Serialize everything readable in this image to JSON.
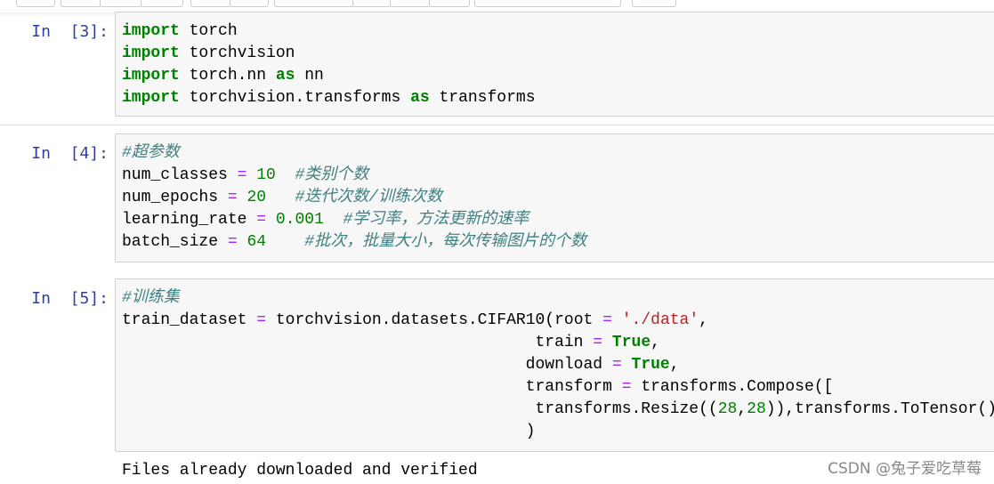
{
  "toolbar": {
    "button_count": 12
  },
  "cells": [
    {
      "prompt": "In  [3]:",
      "lines": [
        [
          {
            "t": "import",
            "c": "kw"
          },
          {
            "t": " torch"
          }
        ],
        [
          {
            "t": "import",
            "c": "kw"
          },
          {
            "t": " torchvision"
          }
        ],
        [
          {
            "t": "import",
            "c": "kw"
          },
          {
            "t": " torch.nn "
          },
          {
            "t": "as",
            "c": "kw"
          },
          {
            "t": " nn"
          }
        ],
        [
          {
            "t": "import",
            "c": "kw"
          },
          {
            "t": " torchvision.transforms "
          },
          {
            "t": "as",
            "c": "kw"
          },
          {
            "t": " transforms"
          }
        ]
      ]
    },
    {
      "prompt": "In  [4]:",
      "lines": [
        [
          {
            "t": "#超参数",
            "c": "cm"
          }
        ],
        [
          {
            "t": "num_classes "
          },
          {
            "t": "=",
            "c": "op"
          },
          {
            "t": " "
          },
          {
            "t": "10",
            "c": "num"
          },
          {
            "t": "  "
          },
          {
            "t": "#类别个数",
            "c": "cm"
          }
        ],
        [
          {
            "t": "num_epochs "
          },
          {
            "t": "=",
            "c": "op"
          },
          {
            "t": " "
          },
          {
            "t": "20",
            "c": "num"
          },
          {
            "t": "   "
          },
          {
            "t": "#迭代次数/训练次数",
            "c": "cm"
          }
        ],
        [
          {
            "t": "learning_rate "
          },
          {
            "t": "=",
            "c": "op"
          },
          {
            "t": " "
          },
          {
            "t": "0.001",
            "c": "num"
          },
          {
            "t": "  "
          },
          {
            "t": "#学习率，方法更新的速率",
            "c": "cm"
          }
        ],
        [
          {
            "t": "batch_size "
          },
          {
            "t": "=",
            "c": "op"
          },
          {
            "t": " "
          },
          {
            "t": "64",
            "c": "num"
          },
          {
            "t": "    "
          },
          {
            "t": "#批次，批量大小，每次传输图片的个数",
            "c": "cm"
          }
        ]
      ]
    },
    {
      "prompt": "In  [5]:",
      "lines": [
        [
          {
            "t": "#训练集",
            "c": "cm"
          }
        ],
        [
          {
            "t": "train_dataset "
          },
          {
            "t": "=",
            "c": "op"
          },
          {
            "t": " torchvision.datasets.CIFAR10(root "
          },
          {
            "t": "=",
            "c": "op"
          },
          {
            "t": " "
          },
          {
            "t": "'./data'",
            "c": "str"
          },
          {
            "t": ","
          }
        ],
        [
          {
            "t": "                                           train "
          },
          {
            "t": "=",
            "c": "op"
          },
          {
            "t": " "
          },
          {
            "t": "True",
            "c": "kw"
          },
          {
            "t": ","
          }
        ],
        [
          {
            "t": "                                          download "
          },
          {
            "t": "=",
            "c": "op"
          },
          {
            "t": " "
          },
          {
            "t": "True",
            "c": "kw"
          },
          {
            "t": ","
          }
        ],
        [
          {
            "t": "                                          transform "
          },
          {
            "t": "=",
            "c": "op"
          },
          {
            "t": " transforms.Compose(["
          }
        ],
        [
          {
            "t": "                                           transforms.Resize(("
          },
          {
            "t": "28",
            "c": "num"
          },
          {
            "t": ","
          },
          {
            "t": "28",
            "c": "num"
          },
          {
            "t": ")),transforms.ToTensor()])"
          }
        ],
        [
          {
            "t": "                                          )"
          }
        ]
      ],
      "output": "Files already downloaded and verified"
    }
  ],
  "watermark": "CSDN @兔子爱吃草莓"
}
